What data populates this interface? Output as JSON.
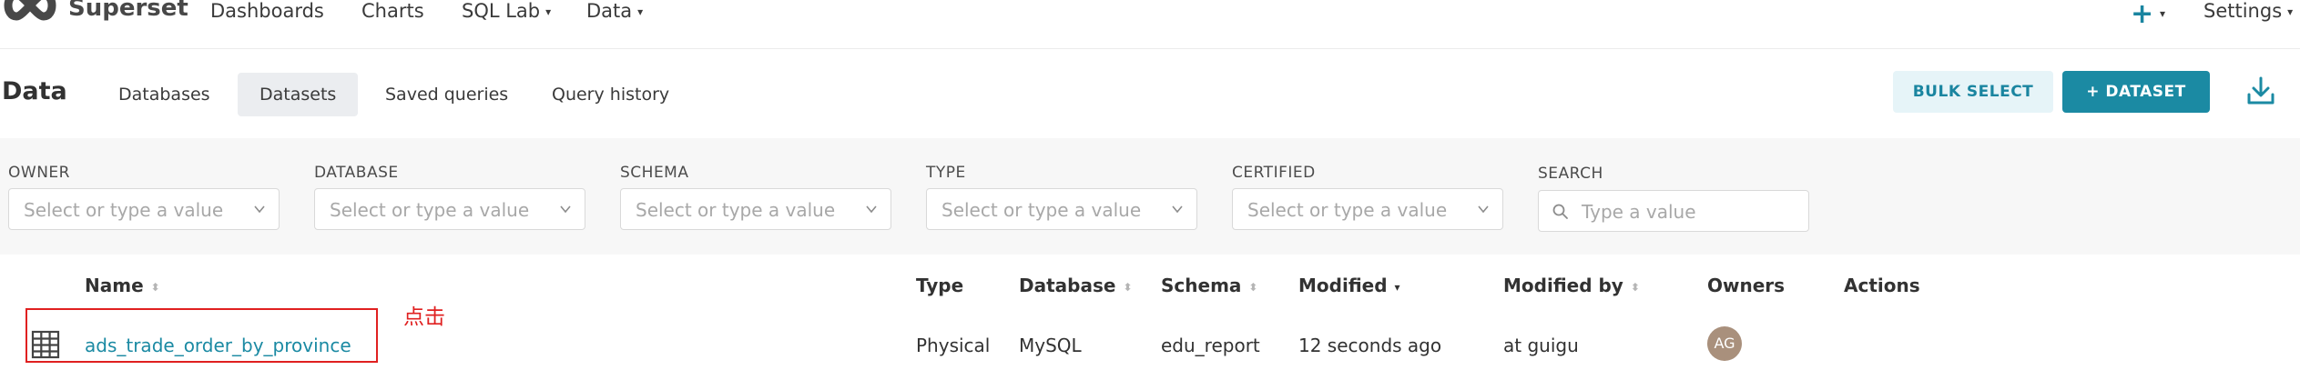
{
  "app": {
    "brand": "Superset",
    "nav": [
      {
        "label": "Dashboards"
      },
      {
        "label": "Charts"
      },
      {
        "label": "SQL Lab",
        "caret": "▾"
      },
      {
        "label": "Data",
        "caret": "▾"
      }
    ],
    "right": {
      "plus": "+",
      "plus_caret": "▾",
      "settings": "Settings",
      "settings_caret": "▾"
    }
  },
  "subheader": {
    "title": "Data",
    "tabs": [
      "Databases",
      "Datasets",
      "Saved queries",
      "Query history"
    ],
    "active_tab": "Datasets",
    "bulk_select": "BULK SELECT",
    "add_dataset": "+ DATASET"
  },
  "filters": [
    {
      "label": "OWNER",
      "placeholder": "Select or type a value"
    },
    {
      "label": "DATABASE",
      "placeholder": "Select or type a value"
    },
    {
      "label": "SCHEMA",
      "placeholder": "Select or type a value"
    },
    {
      "label": "TYPE",
      "placeholder": "Select or type a value"
    },
    {
      "label": "CERTIFIED",
      "placeholder": "Select or type a value"
    },
    {
      "label": "SEARCH",
      "placeholder": "Type a value"
    }
  ],
  "table": {
    "columns": [
      "Name",
      "Type",
      "Database",
      "Schema",
      "Modified",
      "Modified by",
      "Owners",
      "Actions"
    ],
    "sorted_column": "Modified",
    "sort_direction": "descending",
    "rows": [
      {
        "name": "ads_trade_order_by_province",
        "type": "Physical",
        "database": "MySQL",
        "schema": "edu_report",
        "modified": "12 seconds ago",
        "modified_by": "at guigu",
        "owner_initials": "AG"
      }
    ]
  },
  "annotation": {
    "text": "点击",
    "color": "#e02020"
  },
  "colors": {
    "accent": "#1b8aa3",
    "accent_light": "#e6f4f8",
    "avatar": "#a9907c"
  }
}
